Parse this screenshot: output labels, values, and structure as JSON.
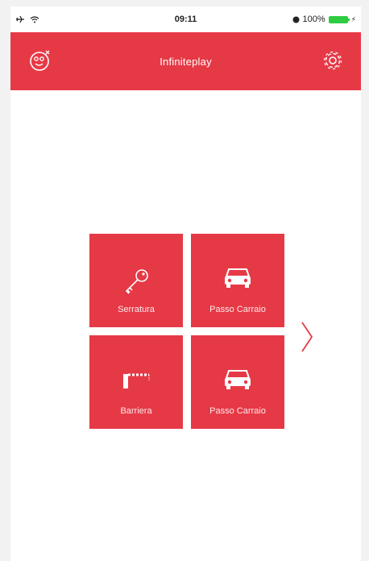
{
  "status_bar": {
    "time": "09:11",
    "battery_percent": "100%",
    "airplane_icon": "airplane-icon",
    "wifi_icon": "wifi-icon",
    "lock_icon": "orientation-lock-icon"
  },
  "header": {
    "title": "Infiniteplay",
    "left_icon": "face-icon",
    "right_icon": "gear-icon",
    "bg_color": "#e63946"
  },
  "tiles": [
    {
      "label": "Serratura",
      "icon": "key-icon"
    },
    {
      "label": "Passo Carraio",
      "icon": "car-icon"
    },
    {
      "label": "Barriera",
      "icon": "barrier-icon"
    },
    {
      "label": "Passo Carraio",
      "icon": "car-icon"
    }
  ],
  "pager": {
    "next_icon": "chevron-right-icon"
  }
}
